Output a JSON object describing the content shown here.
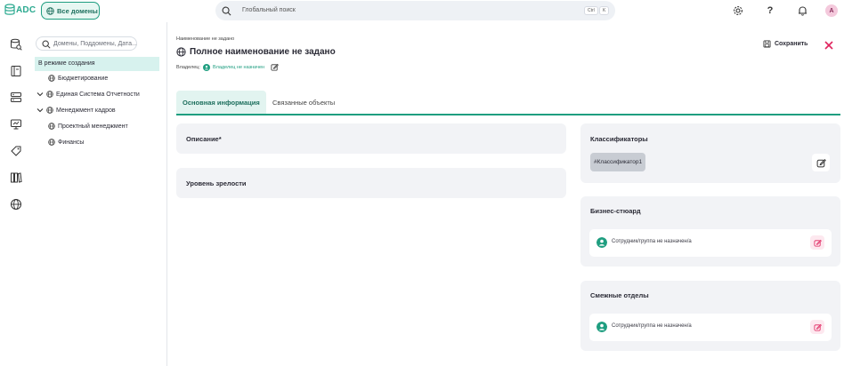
{
  "app": {
    "logo_text": "ADC",
    "domains_button": "Все домены"
  },
  "search": {
    "placeholder": "Глобальный поиск",
    "kbd_ctrl": "Ctrl",
    "kbd_k": "K"
  },
  "user": {
    "avatar_letter": "A"
  },
  "tree": {
    "search_placeholder": "Домены, Поддомены, Дата...",
    "mode_label": "В режиме создания",
    "items": [
      {
        "label": "Бюджетирование"
      },
      {
        "label": "Единая Система Отчетности"
      },
      {
        "label": "Менеджмент кадров"
      },
      {
        "label": "Проектный менеджмент"
      },
      {
        "label": "Финансы"
      }
    ]
  },
  "header": {
    "breadcrumb": "Наименование не задано",
    "title": "Полное наименование не задано",
    "owner_label": "Владелец:",
    "owner_value": "Владелец не назначен",
    "save_label": "Сохранить"
  },
  "tabs": [
    {
      "label": "Основная информация",
      "active": true
    },
    {
      "label": "Связанные объекты",
      "active": false
    }
  ],
  "left_cards": {
    "description_title": "Описание*",
    "maturity_title": "Уровень зрелости"
  },
  "right_cards": {
    "classifiers_title": "Классификаторы",
    "classifier_chip": "#Классификатор1",
    "steward_title": "Бизнес-стюард",
    "steward_value": "Сотрудник/группа не назначен/а",
    "departments_title": "Смежные отделы",
    "departments_value": "Сотрудник/группа не назначен/а"
  },
  "colors": {
    "accent": "#1f9e80",
    "accent_light": "#e2f4f0",
    "card_bg": "#f2f3f6",
    "danger": "#e0245e"
  }
}
